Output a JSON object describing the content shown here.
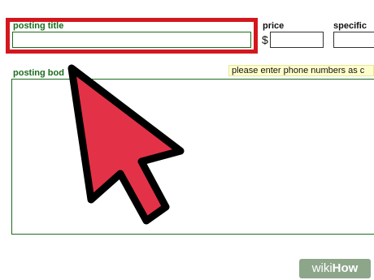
{
  "form": {
    "title_label": "posting title",
    "title_value": "",
    "price_label": "price",
    "currency_symbol": "$",
    "price_value": "",
    "specific_label": "specific",
    "specific_value": "",
    "body_label": "posting bod",
    "body_value": "",
    "phone_hint": "please enter phone numbers as c"
  },
  "annotation": {
    "highlight_color": "#d4171e",
    "arrow_color": "#e33247",
    "arrow_outline": "#000000",
    "arrow_icon": "cursor-arrow-icon"
  },
  "watermark": {
    "part1": "wiki",
    "part2": "How"
  }
}
